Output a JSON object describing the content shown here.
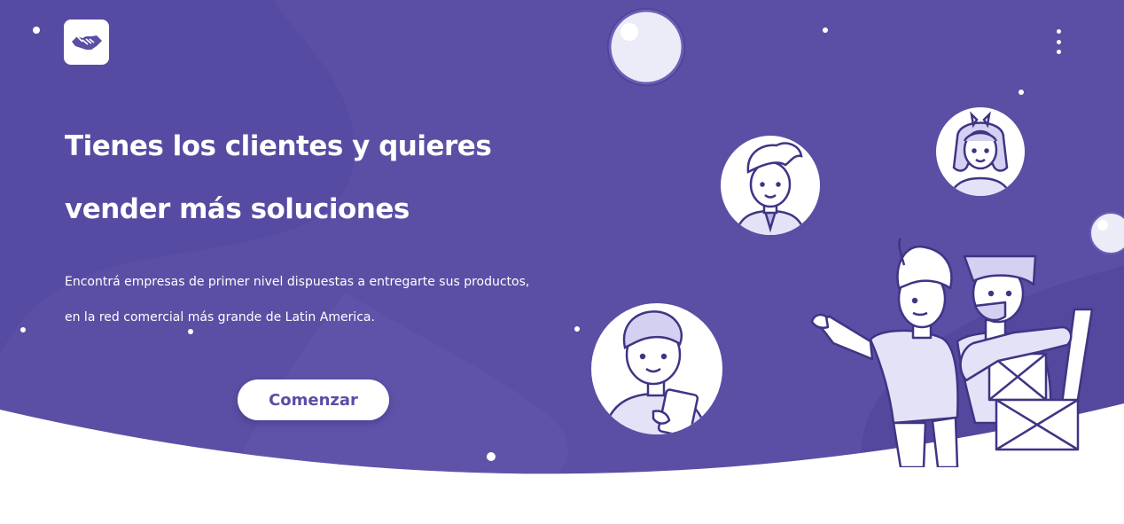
{
  "colors": {
    "hero_primary": "#5a4fa4",
    "hero_blob": "#6157ad",
    "button_text": "#5b4da6",
    "background": "#ffffff"
  },
  "header": {
    "logo_icon": "handshake-icon",
    "menu_icon": "kebab-menu-icon"
  },
  "hero": {
    "headline_line1": "Tienes los clientes y quieres",
    "headline_line2": "vender más soluciones",
    "subtext_line1": "Encontrá empresas de primer nivel dispuestas a entregarte sus productos,",
    "subtext_line2": "en la red comercial más grande de Latin America.",
    "cta_label": "Comenzar"
  },
  "illustration": {
    "avatars": [
      "man-with-tie-avatar",
      "girl-with-bow-avatar",
      "boy-with-tablet-avatar"
    ],
    "scene": "two-men-with-boxes-illustration"
  }
}
